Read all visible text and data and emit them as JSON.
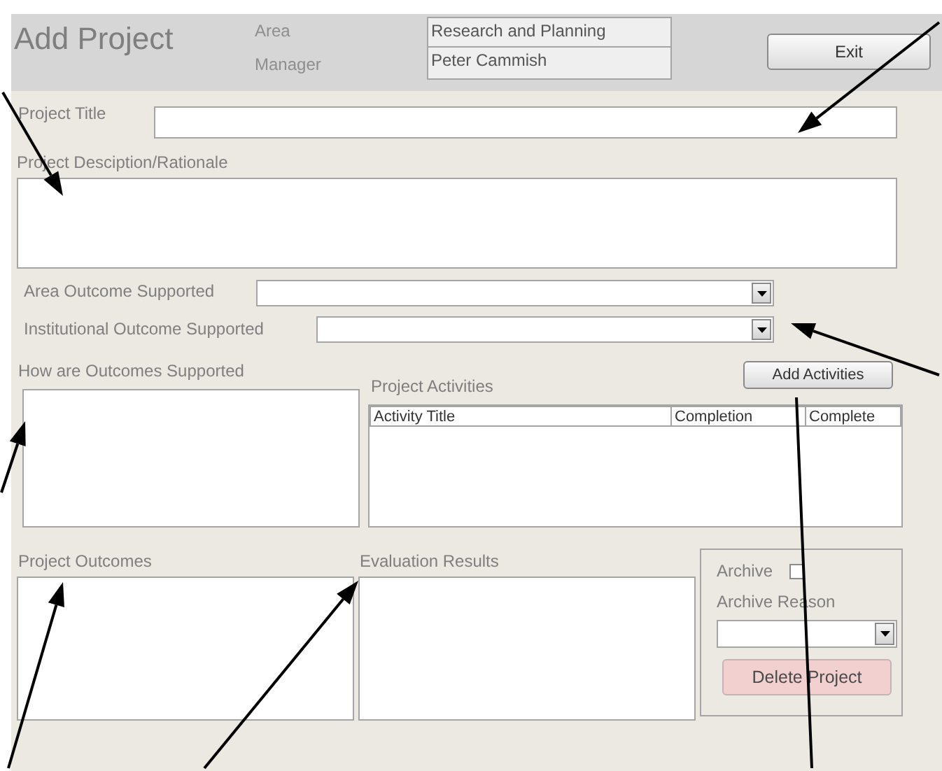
{
  "header": {
    "title": "Add Project",
    "area": {
      "label": "Area",
      "value": "Research and Planning"
    },
    "manager": {
      "label": "Manager",
      "value": "Peter Cammish"
    },
    "exit_button": "Exit"
  },
  "fields": {
    "project_title": {
      "label": "Project Title"
    },
    "description": {
      "label": "Project Desciption/Rationale"
    },
    "area_outcome": {
      "label": "Area Outcome Supported"
    },
    "institutional_outcome": {
      "label": "Institutional Outcome Supported"
    },
    "how_supported": {
      "label": "How are Outcomes Supported"
    },
    "project_outcomes": {
      "label": "Project Outcomes"
    },
    "evaluation_results": {
      "label": "Evaluation Results"
    }
  },
  "activities": {
    "label": "Project Activities",
    "add_button": "Add Activities",
    "columns": [
      "Activity Title",
      "Completion",
      "Complete"
    ]
  },
  "archive": {
    "label": "Archive",
    "checked": false,
    "reason_label": "Archive Reason",
    "delete_button": "Delete Project"
  }
}
